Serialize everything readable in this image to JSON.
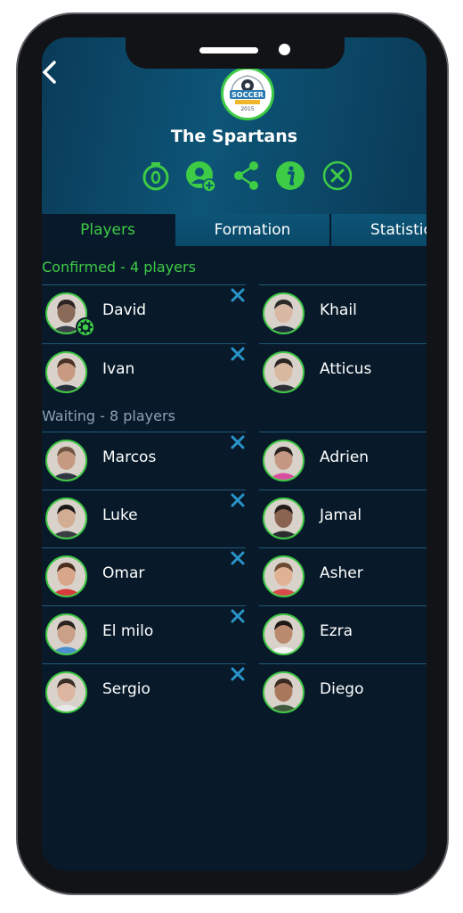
{
  "app": {
    "team_name": "The Spartans",
    "logo_text": "SOCCER",
    "logo_year": "2015"
  },
  "actions": [
    "timer-icon",
    "add-player-icon",
    "share-icon",
    "info-icon",
    "close-circle-icon"
  ],
  "tabs": [
    {
      "label": "Players"
    },
    {
      "label": "Formation"
    },
    {
      "label": "Statistics"
    }
  ],
  "sections": {
    "confirmed": "Confirmed - 4 players",
    "waiting": "Waiting - 8 players"
  },
  "confirmed_players": [
    {
      "name": "David",
      "removable": true,
      "admin": true,
      "skin": "#8a6a58",
      "hair": "#2b2422",
      "shirt": "#3a4048"
    },
    {
      "name": "Khail",
      "removable": false,
      "skin": "#d8b8a5",
      "hair": "#2c2a28",
      "shirt": "#1e2b38"
    },
    {
      "name": "Ivan",
      "removable": true,
      "skin": "#c89a82",
      "hair": "#4a3226",
      "shirt": "#26303a"
    },
    {
      "name": "Atticus",
      "removable": false,
      "skin": "#d9b8a0",
      "hair": "#2a2422",
      "shirt": "#2b2f35"
    }
  ],
  "waiting_players": [
    {
      "name": "Marcos",
      "removable": true,
      "skin": "#c59a80",
      "hair": "#6f5642",
      "shirt": "#2e3640"
    },
    {
      "name": "Adrien",
      "removable": false,
      "skin": "#c49882",
      "hair": "#2a2220",
      "shirt": "#d84fa0"
    },
    {
      "name": "Luke",
      "removable": true,
      "skin": "#d3ac94",
      "hair": "#1e1a18",
      "shirt": "#3a3d44"
    },
    {
      "name": "Jamal",
      "removable": false,
      "skin": "#8a6450",
      "hair": "#231b17",
      "shirt": "#2a2c30"
    },
    {
      "name": "Omar",
      "removable": true,
      "skin": "#d8a688",
      "hair": "#4a2e1e",
      "shirt": "#d83b3b"
    },
    {
      "name": "Asher",
      "removable": false,
      "skin": "#dfb294",
      "hair": "#6b4a33",
      "shirt": "#d94a4a"
    },
    {
      "name": "El milo",
      "removable": true,
      "skin": "#caa088",
      "hair": "#2b231f",
      "shirt": "#4a8fd0"
    },
    {
      "name": "Ezra",
      "removable": false,
      "skin": "#b98a6e",
      "hair": "#1f1916",
      "shirt": "#f2f2f2"
    },
    {
      "name": "Sergio",
      "removable": true,
      "skin": "#dcb6a0",
      "hair": "#3a2e28",
      "shirt": "#e8e8e8"
    },
    {
      "name": "Diego",
      "removable": false,
      "skin": "#a9785c",
      "hair": "#3b2a21",
      "shirt": "#3e5a3a"
    }
  ],
  "colors": {
    "accent_green": "#3ecb45",
    "remove_blue": "#2a94c9",
    "background": "#081a2a",
    "header": "#0d5577"
  }
}
